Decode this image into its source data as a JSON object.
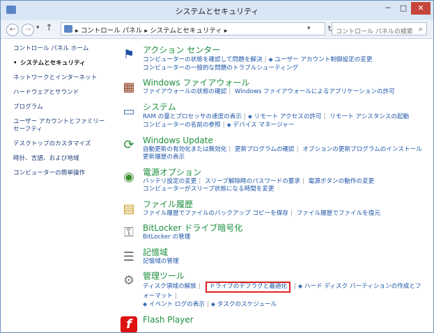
{
  "window": {
    "title": "システムとセキュリティ",
    "controls": {
      "minimize": "─",
      "maximize": "□",
      "close": "✕"
    }
  },
  "nav": {
    "back": "←",
    "forward": "→",
    "dropdown": "▾",
    "up": "↑",
    "breadcrumb": "▸ コントロール パネル ▸ システムとセキュリティ ▸",
    "address_dropdown": "▾",
    "refresh": "↻",
    "search_placeholder": "コントロール パネルの検索",
    "search_icon": "⌕"
  },
  "sidebar": {
    "items": [
      {
        "label": "コントロール パネル ホーム",
        "current": false
      },
      {
        "label": "システムとセキュリティ",
        "current": true
      },
      {
        "label": "ネットワークとインターネット",
        "current": false
      },
      {
        "label": "ハードウェアとサウンド",
        "current": false
      },
      {
        "label": "プログラム",
        "current": false
      },
      {
        "label": "ユーザー アカウントとファミリー セーフティ",
        "current": false
      },
      {
        "label": "デスクトップのカスタマイズ",
        "current": false
      },
      {
        "label": "時計、言語、および地域",
        "current": false
      },
      {
        "label": "コンピューターの簡単操作",
        "current": false
      }
    ]
  },
  "categories": {
    "action_center": {
      "icon": "⚑",
      "title": "アクション センター",
      "links": [
        "コンピューターの状態を確認して問題を解決",
        "ユーザー アカウント制御設定の変更",
        "コンピューターの一般的な問題のトラブルシューティング"
      ]
    },
    "firewall": {
      "icon": "▦",
      "title": "Windows ファイアウォール",
      "links": [
        "ファイアウォールの状態の確認",
        "Windows ファイアウォールによるアプリケーションの許可"
      ]
    },
    "system": {
      "icon": "▭",
      "title": "システム",
      "links": [
        "RAM の量とプロセッサの速度の表示",
        "リモート アクセスの許可",
        "リモート アシスタンスの起動",
        "コンピューターの名前の参照",
        "デバイス マネージャー"
      ]
    },
    "windows_update": {
      "icon": "⟳",
      "title": "Windows Update",
      "links": [
        "自動更新の有効化または無効化",
        "更新プログラムの確認",
        "オプションの更新プログラムのインストール",
        "更新履歴の表示"
      ]
    },
    "power": {
      "icon": "◉",
      "title": "電源オプション",
      "links": [
        "バッテリ設定の変更",
        "スリープ解除時のパスワードの要求",
        "電源ボタンの動作の変更",
        "コンピューターがスリープ状態になる時間を変更"
      ]
    },
    "file_history": {
      "icon": "▤",
      "title": "ファイル履歴",
      "links": [
        "ファイル履歴でファイルのバックアップ コピーを保存",
        "ファイル履歴でファイルを復元"
      ]
    },
    "bitlocker": {
      "icon": "⚿",
      "title": "BitLocker ドライブ暗号化",
      "links": [
        "BitLocker の管理"
      ]
    },
    "storage": {
      "icon": "☰",
      "title": "記憶域",
      "links": [
        "記憶域の管理"
      ]
    },
    "admin_tools": {
      "icon": "⚙",
      "title": "管理ツール",
      "links": [
        "ディスク領域の解放",
        "ドライブのデフラグと最適化",
        "ハード ディスク パーティションの作成とフォーマット",
        "イベント ログの表示",
        "タスクのスケジュール"
      ]
    },
    "flash": {
      "icon": "f",
      "title": "Flash Player",
      "links": []
    }
  },
  "colors": {
    "title_green": "#1c8f3f",
    "link_blue": "#1e55a8",
    "highlight_red": "#e02020"
  }
}
